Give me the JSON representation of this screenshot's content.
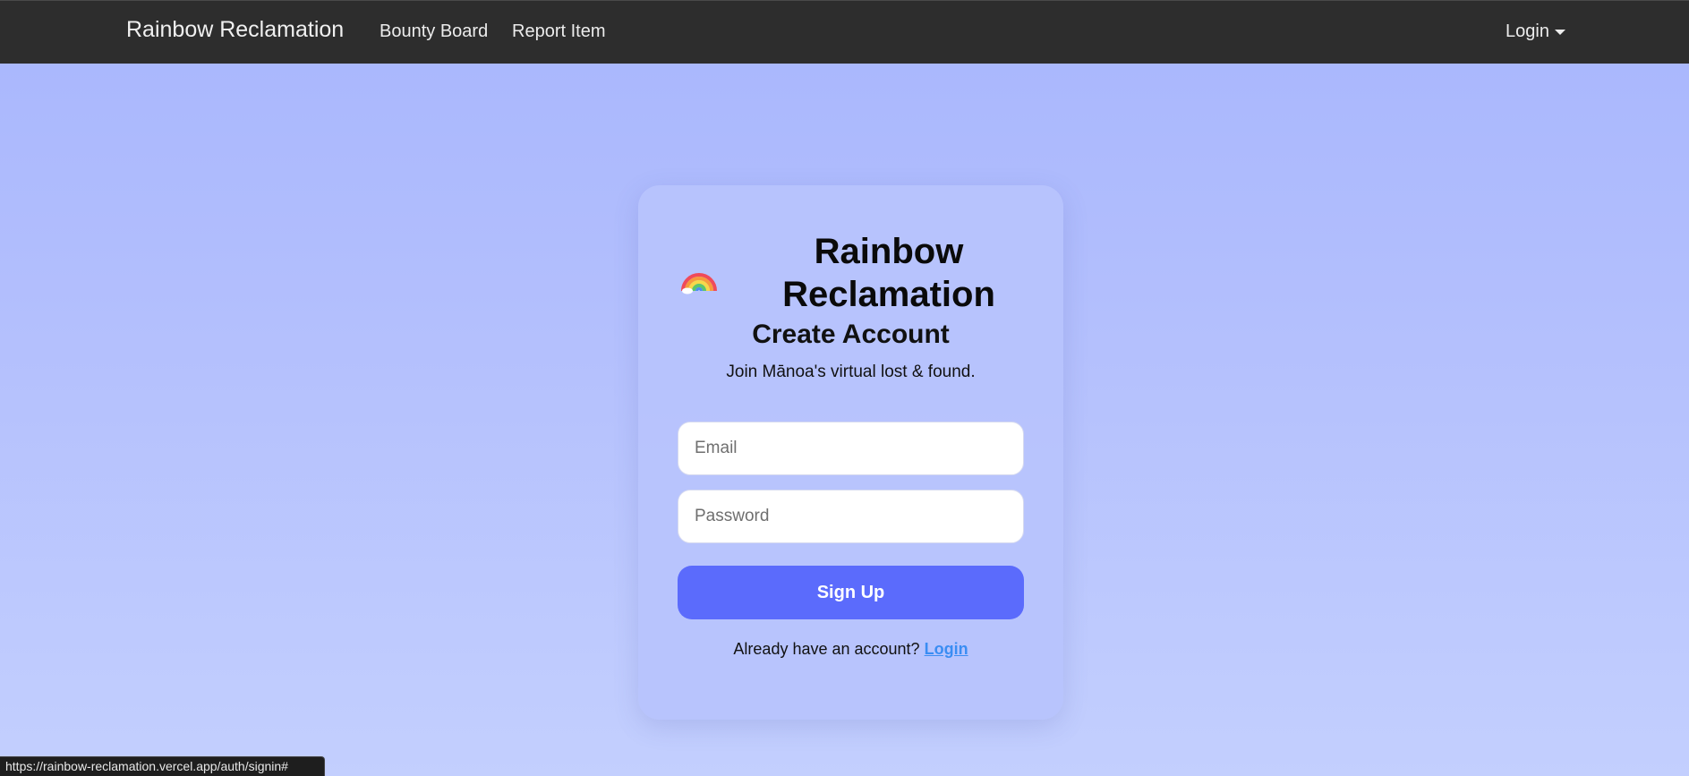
{
  "navbar": {
    "brand": "Rainbow Reclamation",
    "links": [
      "Bounty Board",
      "Report Item"
    ],
    "login_label": "Login"
  },
  "card": {
    "logo_icon": "rainbow-emoji",
    "title": "Rainbow Reclamation",
    "subtitle": "Create Account",
    "tagline": "Join Mānoa's virtual lost & found.",
    "email_placeholder": "Email",
    "password_placeholder": "Password",
    "signup_label": "Sign Up",
    "footer_prompt": "Already have an account?",
    "footer_link": "Login"
  },
  "status_bar": {
    "url": "https://rainbow-reclamation.vercel.app/auth/signin#"
  },
  "colors": {
    "navbar_bg": "#2d2d2d",
    "button_bg": "#5b6bfc",
    "link": "#3a8df3"
  }
}
